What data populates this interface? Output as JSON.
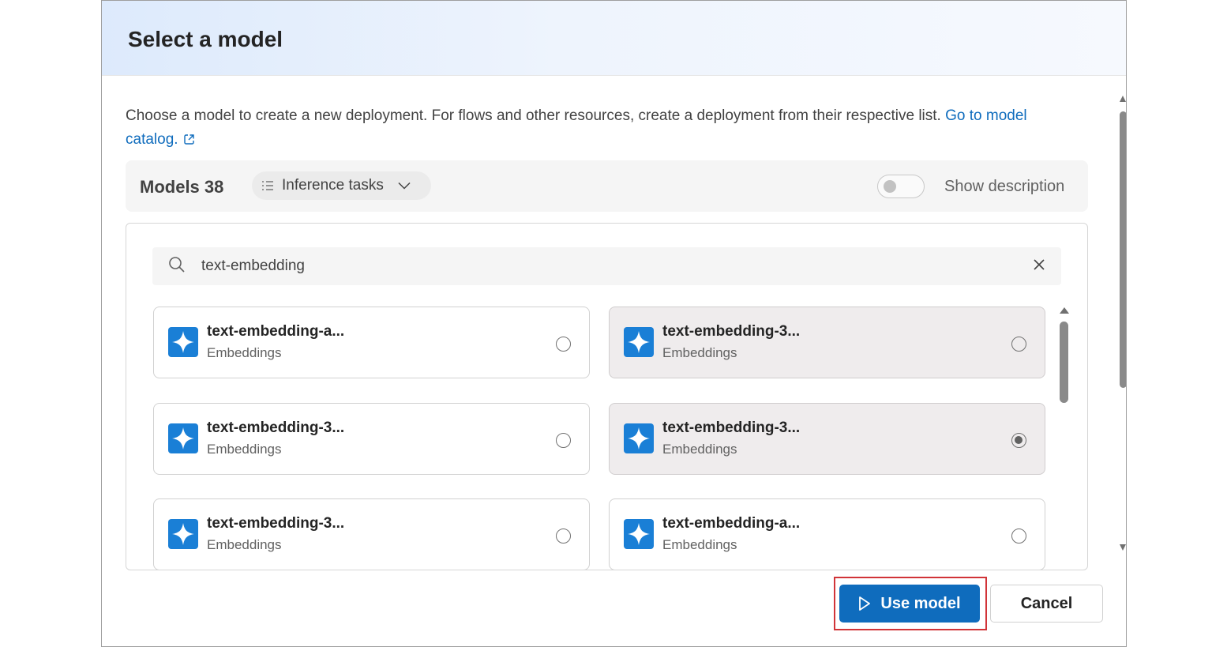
{
  "dialog": {
    "title": "Select a model",
    "description": "Choose a model to create a new deployment. For flows and other resources, create a deployment from their respective list.",
    "catalog_link": "Go to model catalog."
  },
  "toolbar": {
    "models_label": "Models 38",
    "filter_label": "Inference tasks",
    "toggle_label": "Show description",
    "toggle_on": false
  },
  "search": {
    "value": "text-embedding"
  },
  "models": [
    {
      "name": "text-embedding-a...",
      "type": "Embeddings",
      "selected": false
    },
    {
      "name": "text-embedding-3...",
      "type": "Embeddings",
      "selected": false
    },
    {
      "name": "text-embedding-3...",
      "type": "Embeddings",
      "selected": false
    },
    {
      "name": "text-embedding-3...",
      "type": "Embeddings",
      "selected": true
    },
    {
      "name": "text-embedding-3...",
      "type": "Embeddings",
      "selected": false
    },
    {
      "name": "text-embedding-a...",
      "type": "Embeddings",
      "selected": false
    }
  ],
  "footer": {
    "use_label": "Use model",
    "cancel_label": "Cancel"
  },
  "icons": {
    "external": "open-in-new-icon",
    "filter": "list-filter-icon",
    "chevron": "chevron-down-icon",
    "search": "search-icon",
    "clear": "dismiss-icon",
    "model": "sparkle-model-icon",
    "play": "play-icon"
  },
  "colors": {
    "accent": "#0f6cbd",
    "highlight": "#d13438",
    "selected_card_bg": "#efeced"
  }
}
